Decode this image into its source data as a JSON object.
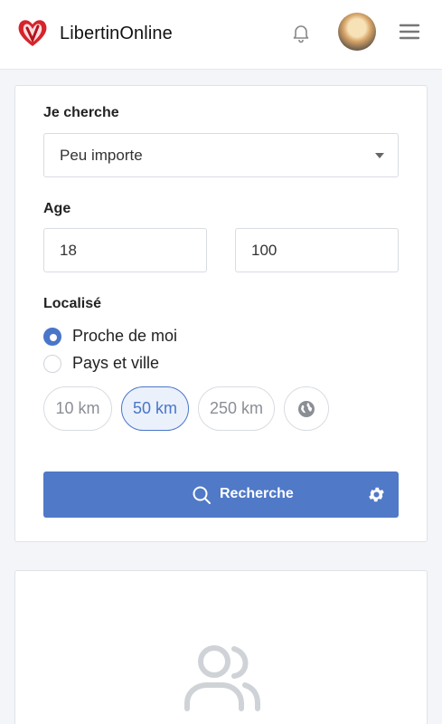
{
  "header": {
    "brand": "LibertinOnline",
    "icons": {
      "logo": "heart-logo-icon",
      "bell": "bell-icon",
      "avatar": "user-avatar",
      "menu": "hamburger-menu-icon"
    }
  },
  "search": {
    "seeking_label": "Je cherche",
    "seeking_value": "Peu importe",
    "age_label": "Age",
    "age_min": "18",
    "age_max": "100",
    "location_label": "Localisé",
    "radio_near": "Proche de moi",
    "radio_country": "Pays et ville",
    "selected_radio": "Proche de moi",
    "distances": [
      "10 km",
      "50 km",
      "250 km"
    ],
    "selected_distance": "50 km",
    "world_icon": "globe-icon",
    "button_label": "Recherche"
  },
  "results": {
    "empty_icon": "users-icon"
  },
  "colors": {
    "accent": "#5079c7",
    "active_pill_bg": "#eaf1fb",
    "brand_red": "#d6242c"
  }
}
